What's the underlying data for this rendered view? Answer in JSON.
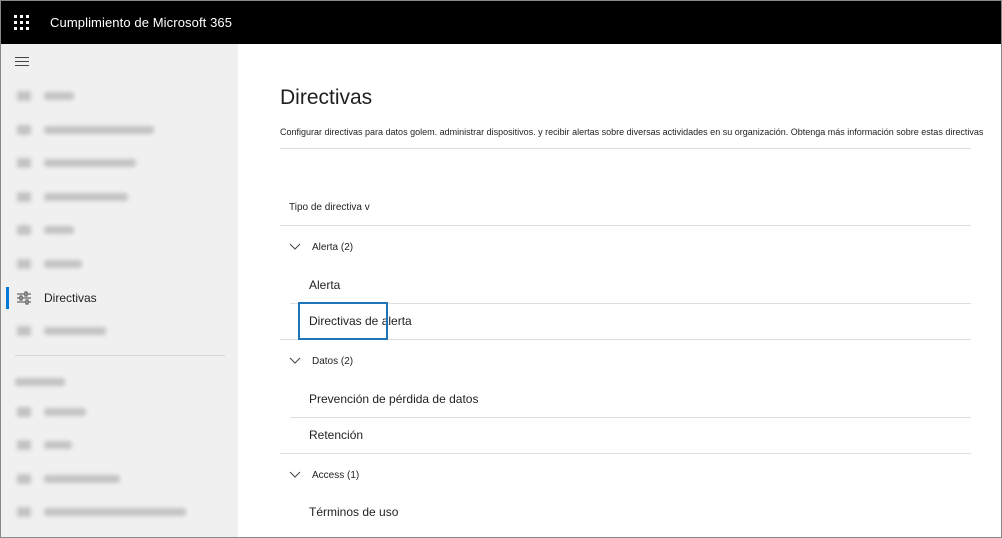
{
  "app": {
    "title": "Cumplimiento de Microsoft 365"
  },
  "sidebar": {
    "items": [
      {
        "label": "Home",
        "blurred": true
      },
      {
        "label": "Compliance Manager",
        "blurred": true
      },
      {
        "label": "Data classification",
        "blurred": true
      },
      {
        "label": "Data connectors",
        "blurred": true
      },
      {
        "label": "Alerts",
        "blurred": true
      },
      {
        "label": "Reports",
        "blurred": true
      },
      {
        "label": "Directivas",
        "blurred": false,
        "active": true
      },
      {
        "label": "Permissions",
        "blurred": true
      }
    ],
    "section_heading": "Solutions",
    "section_items": [
      {
        "label": "Catalog",
        "blurred": true
      },
      {
        "label": "Audit",
        "blurred": true
      },
      {
        "label": "Content search",
        "blurred": true
      },
      {
        "label": "Communication compliance",
        "blurred": true
      }
    ]
  },
  "main": {
    "title": "Directivas",
    "description": "Configurar directivas para datos golem. administrar dispositivos. y recibir alertas sobre diversas actividades en su organización. Obtenga más información sobre estas directivas",
    "filter_label": "Tipo de directiva v",
    "groups": [
      {
        "label": "Alerta (2)",
        "items": [
          "Alerta",
          "Directivas de alerta"
        ]
      },
      {
        "label": "Datos (2)",
        "items": [
          "Prevención de pérdida de datos",
          "Retención"
        ]
      },
      {
        "label": "Access (1)",
        "items": [
          "Términos de uso"
        ]
      }
    ]
  },
  "colors": {
    "accent": "#0078d4",
    "highlight": "#1f73b7",
    "topbar": "#000000",
    "sidebar_bg": "#f0f0f0"
  }
}
